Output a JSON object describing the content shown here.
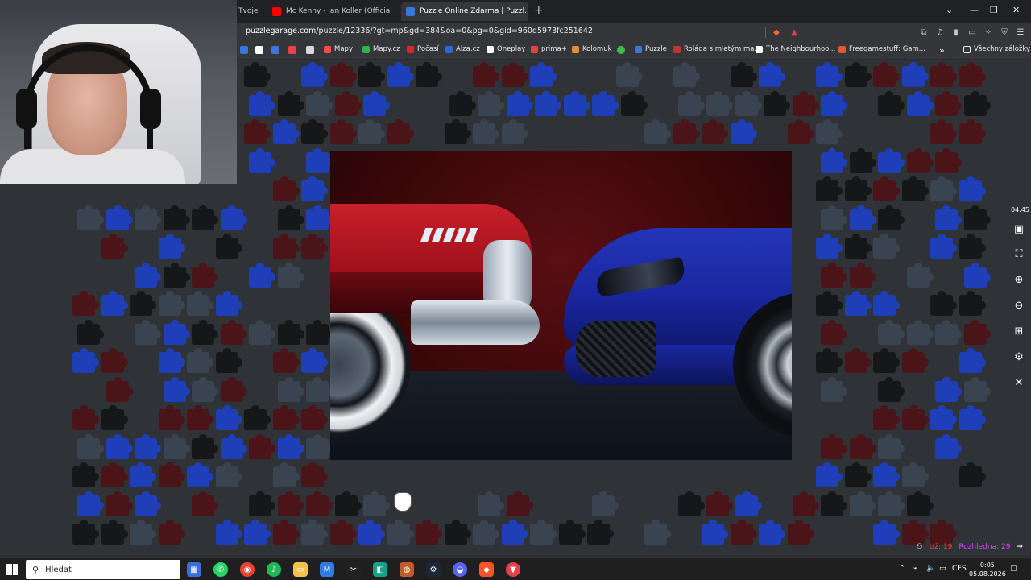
{
  "browser": {
    "tabs": [
      {
        "title": "Tvoje",
        "favicon_color": "#ff2d2d"
      },
      {
        "title": "Mc Kenny - Jan Koller (Official Vid...",
        "favicon_color": "#ff0000"
      },
      {
        "title": "Puzzle Online Zdarma | Puzzl...",
        "favicon_color": "#3a78d8",
        "active": true
      }
    ],
    "new_tab_label": "+",
    "close_tab_label": "×",
    "url_domain": "puzzlegarage.com",
    "url_path": "/puzzle/12336/?gt=mp&gd=384&oa=0&pg=0&gid=960d5973fc251642"
  },
  "bookmarks": [
    {
      "label": "Mapy",
      "color": "#ff4d4d"
    },
    {
      "label": "Mapy.cz",
      "color": "#2fb34a"
    },
    {
      "label": "Počasí",
      "color": "#e0262d"
    },
    {
      "label": "Alza.cz",
      "color": "#2a6ad8"
    },
    {
      "label": "Oneplay",
      "color": "#ffffff"
    },
    {
      "label": "prima+",
      "color": "#e8414b"
    },
    {
      "label": "Kolomuk",
      "color": "#e88b2b"
    },
    {
      "label": "Puzzle",
      "color": "#3a78d8"
    },
    {
      "label": "Roláda s mletým ma...",
      "color": "#c2352e"
    },
    {
      "label": "The Neighbourhoo...",
      "color": "#ffffff"
    },
    {
      "label": "Freegamestuff: Gam...",
      "color": "#e05a2b"
    }
  ],
  "bookmarks_more": "»",
  "all_bookmarks_label": "Všechny záložky",
  "game": {
    "timer": "04:45",
    "status_ok_label": "Už: 19",
    "status_vis_label": "Rozhledna: 29"
  },
  "taskbar": {
    "search_placeholder": "Hledat",
    "language": "CES",
    "time": "0:05",
    "date": "05.08.2026"
  },
  "colors": {
    "piece_red": "#4a1418",
    "piece_blue": "#1e3fb8",
    "piece_black": "#151719",
    "piece_slate": "#3a4350"
  }
}
